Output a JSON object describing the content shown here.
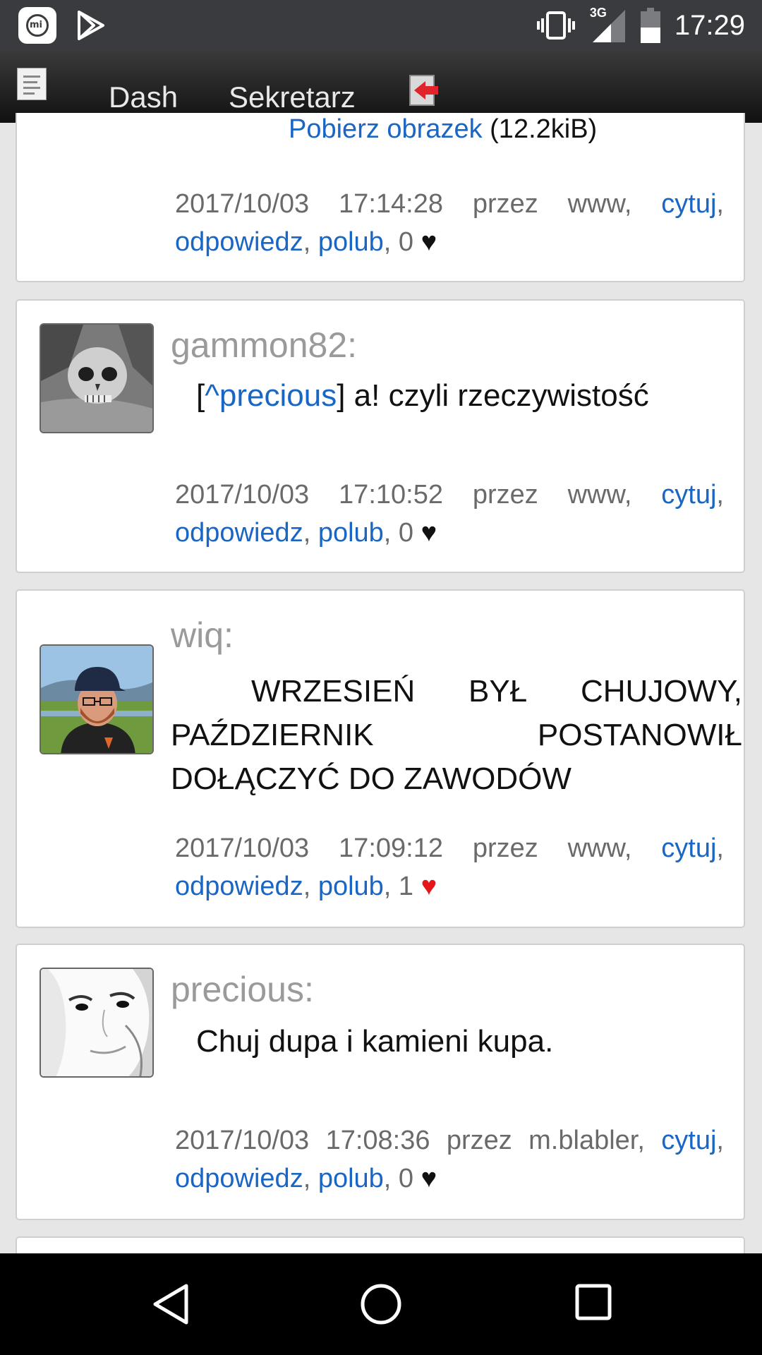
{
  "status_bar": {
    "time": "17:29",
    "network": "3G",
    "mi_label": "mi",
    "icons": [
      "mi-icon",
      "play-store-icon",
      "vibrate-icon",
      "signal-icon",
      "battery-icon"
    ]
  },
  "header": {
    "nav": [
      "Dash",
      "Sekretarz"
    ],
    "icons": [
      "menu-icon",
      "logout-icon"
    ]
  },
  "posts": [
    {
      "partial_link": "Pobierz obrazek",
      "partial_size": "(12.2kiB)",
      "date": "2017/10/03",
      "time": "17:14:28",
      "via": "przez",
      "source": "www,",
      "quote": "cytuj",
      "reply": "odpowiedz",
      "like": "polub",
      "likes": "0"
    },
    {
      "user": "gammon82:",
      "ref_open": "[",
      "ref_name": "^precious",
      "ref_close": "]",
      "text": " a! czyli rzeczywistość",
      "date": "2017/10/03",
      "time": "17:10:52",
      "via": "przez",
      "source": "www,",
      "quote": "cytuj",
      "reply": "odpowiedz",
      "like": "polub",
      "likes": "0"
    },
    {
      "user": "wiq:",
      "text_words": [
        "WRZESIEŃ",
        "BYŁ",
        "CHUJOWY,",
        "PAŹDZIERNIK",
        "POSTANOWIŁ",
        "DOŁĄCZYĆ DO ZAWODÓW"
      ],
      "date": "2017/10/03",
      "time": "17:09:12",
      "via": "przez",
      "source": "www,",
      "quote": "cytuj",
      "reply": "odpowiedz",
      "like": "polub",
      "likes": "1",
      "liked": true
    },
    {
      "user": "precious:",
      "text": "Chuj dupa i kamieni kupa.",
      "date": "2017/10/03",
      "time": "17:08:36",
      "via": "przez",
      "source": "m.blabler,",
      "quote": "cytuj",
      "reply": "odpowiedz",
      "like": "polub",
      "likes": "0"
    }
  ],
  "separators": {
    "comma": ",",
    "heart": "♥"
  },
  "colors": {
    "link": "#1a66c4",
    "heart_liked": "#e5161a",
    "statusbar": "#3a3b3f"
  },
  "nav_bar": [
    "back-icon",
    "home-icon",
    "recents-icon"
  ]
}
